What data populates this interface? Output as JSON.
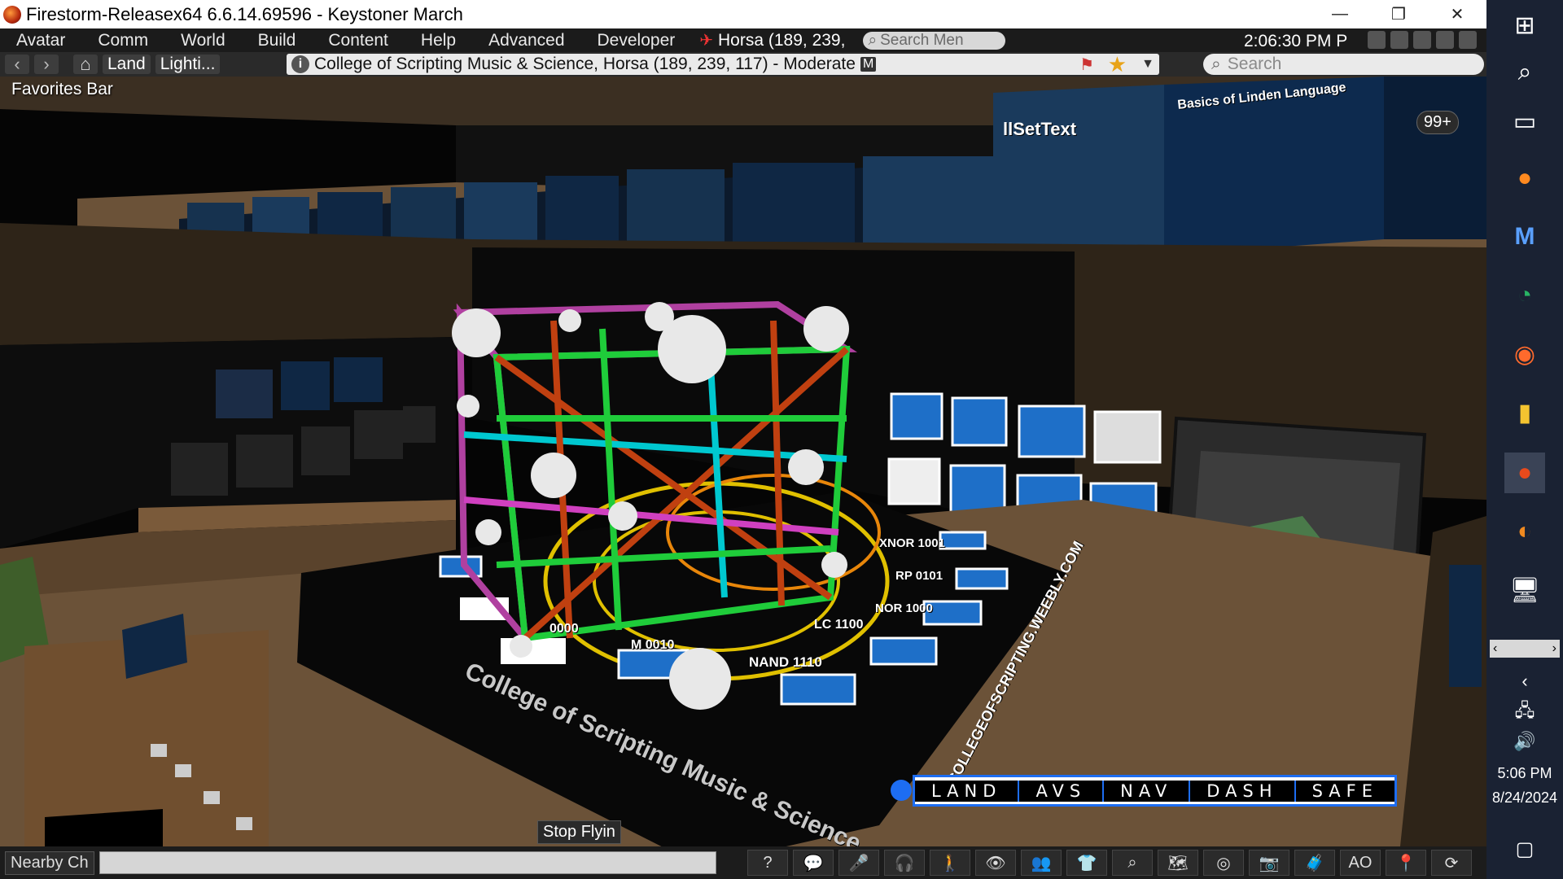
{
  "window": {
    "title": "Firestorm-Releasex64 6.6.14.69596 - Keystoner March",
    "controls": [
      "minimize",
      "restore",
      "close"
    ]
  },
  "menu": {
    "items": [
      "Avatar",
      "Comm",
      "World",
      "Build",
      "Content",
      "Help",
      "Advanced",
      "Developer"
    ],
    "location": "Horsa (189, 239,",
    "search_placeholder": "Search Men",
    "clock": "2:06:30 PM P"
  },
  "navbar": {
    "back": "back-icon",
    "forward": "forward-icon",
    "home": "home-icon",
    "land": "Land",
    "lighting": "Lighti...",
    "address": "College of Scripting Music & Science, Horsa (189, 239, 117) - Moderate",
    "maturity_badge": "M",
    "search_placeholder": "Search"
  },
  "scene": {
    "favorites_bar": "Favorites Bar",
    "notification_count": "99+",
    "board_title": "Basics of Linden Language",
    "board_set_text": "llSetText",
    "floor_text": "College of Scripting Music & Science",
    "floor_url": "COLLEGEOFSCRIPTING.WEEBLY.COM",
    "floor_labels": [
      "XNOR 1001",
      "RP 0101",
      "NOR 1000",
      "LC 1100",
      "NAND 1110",
      "M 0010",
      "0000"
    ],
    "stop_flying": "Stop Flyin"
  },
  "hud": {
    "buttons": [
      "LAND",
      "AVS",
      "NAV",
      "DASH",
      "SAFE"
    ],
    "accent": "#1d6df2"
  },
  "bottombar": {
    "nearby_chat": "Nearby Ch",
    "tools": [
      "help-icon",
      "speak-icon",
      "mic-icon",
      "voice-icon",
      "move-icon",
      "view-icon",
      "people-icon",
      "appearance-icon",
      "search-icon",
      "map-icon",
      "minimap-icon",
      "radar-icon",
      "snapshot-icon",
      "inventory-icon",
      "ao-icon",
      "places-icon",
      "refresh-icon"
    ],
    "ao_label": "AO"
  },
  "taskbar": {
    "time": "5:06 PM",
    "date": "8/24/2024",
    "apps": [
      "windows-icon",
      "search-icon",
      "taskview-icon",
      "firefox-icon",
      "mathcad-icon",
      "edge-icon",
      "avast-icon",
      "files-icon",
      "firestorm-icon",
      "app-icon",
      "monitor-icon"
    ]
  }
}
